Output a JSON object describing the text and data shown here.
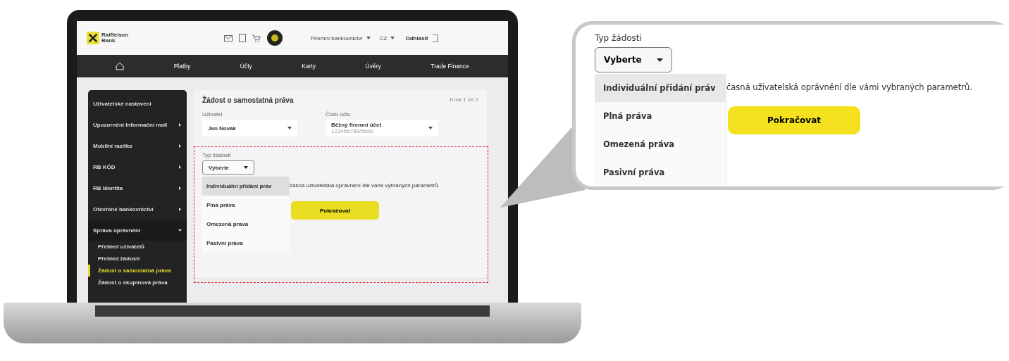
{
  "header": {
    "logo": "Raiffeisen Bank",
    "account_switch": "Firemní bankovnictví",
    "language": "CZ",
    "logout": "Odhlásit"
  },
  "nav": [
    {
      "label": "Platby"
    },
    {
      "label": "Účty"
    },
    {
      "label": "Karty"
    },
    {
      "label": "Úvěry"
    },
    {
      "label": "Trade Finance"
    }
  ],
  "sidebar": {
    "items": [
      {
        "label": "Uživatelské nastavení",
        "kind": "link"
      },
      {
        "label": "Upozornění Informační mail",
        "kind": "group",
        "expanded": false
      },
      {
        "label": "Mobilní razítko",
        "kind": "group",
        "expanded": false
      },
      {
        "label": "RB KÓD",
        "kind": "group",
        "expanded": false
      },
      {
        "label": "RB Identita",
        "kind": "group",
        "expanded": false
      },
      {
        "label": "Otevřené bankovnictví",
        "kind": "group",
        "expanded": false
      },
      {
        "label": "Správa oprávnění",
        "kind": "group",
        "expanded": true,
        "children": [
          {
            "label": "Přehled uživatelů",
            "selected": false
          },
          {
            "label": "Přehled žádostí",
            "selected": false
          },
          {
            "label": "Žádost o samostatná práva",
            "selected": true
          },
          {
            "label": "Žádost o skupinová práva",
            "selected": false
          }
        ]
      }
    ]
  },
  "form": {
    "title": "Žádost o samostatná práva",
    "step": "Krok 1 ze 2",
    "user_label": "Uživatel",
    "user_value": "Jan Novák",
    "account_label": "Číslo účtu",
    "account_name": "Běžný firemní účet",
    "account_number": "123456789/5500",
    "type_label": "Typ žádosti",
    "type_value": "Vyberte",
    "options": [
      {
        "label": "Individuální přidání práv",
        "selected": true
      },
      {
        "label": "Plná práva",
        "selected": false
      },
      {
        "label": "Omezená práva",
        "selected": false
      },
      {
        "label": "Pasivní práva",
        "selected": false
      }
    ],
    "description": "časná uživatelská oprávnění dle vámi vybraných parametrů.",
    "button": "Pokračovat"
  },
  "callout": {
    "type_label": "Typ žádosti",
    "type_value": "Vyberte",
    "options": [
      {
        "label": "Individuální přidání práv",
        "selected": true
      },
      {
        "label": "Plná práva",
        "selected": false
      },
      {
        "label": "Omezená práva",
        "selected": false
      },
      {
        "label": "Pasivní práva",
        "selected": false
      }
    ],
    "description": "časná uživatelská oprávnění dle vámi vybraných parametrů.",
    "button": "Pokračovat"
  }
}
